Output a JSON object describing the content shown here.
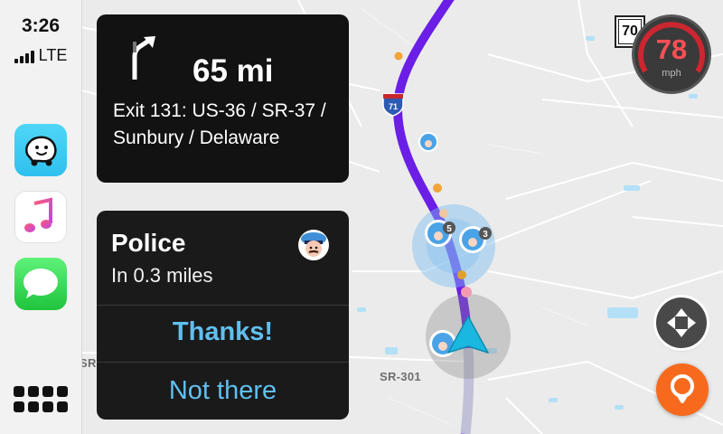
{
  "status_bar": {
    "time": "3:26",
    "network": "LTE"
  },
  "sidebar": {
    "apps": [
      {
        "name": "Waze",
        "icon": "waze-app-icon"
      },
      {
        "name": "Music",
        "icon": "music-app-icon"
      },
      {
        "name": "Messages",
        "icon": "messages-app-icon"
      }
    ],
    "home_icon": "app-grid-icon"
  },
  "navigation": {
    "maneuver_icon": "turn-slight-right-icon",
    "distance": "65 mi",
    "instruction": "Exit 131: US-36 / SR-37 / Sunbury / Delaware"
  },
  "alert": {
    "title": "Police",
    "distance": "In 0.3 miles",
    "icon": "police-icon",
    "confirm_label": "Thanks!",
    "dismiss_label": "Not there"
  },
  "map": {
    "road_labels": [
      "SR-301",
      "SR-"
    ],
    "interstate_shield": "71",
    "report_counts": [
      "5",
      "3"
    ],
    "route_color": "#6a1ee6",
    "water_color": "#b3e0f6"
  },
  "speed": {
    "limit": "70",
    "current": "78",
    "unit": "mph"
  },
  "colors": {
    "accent": "#60bff0",
    "speed_warning": "#ff4f55",
    "report_button": "#f76a1e"
  }
}
